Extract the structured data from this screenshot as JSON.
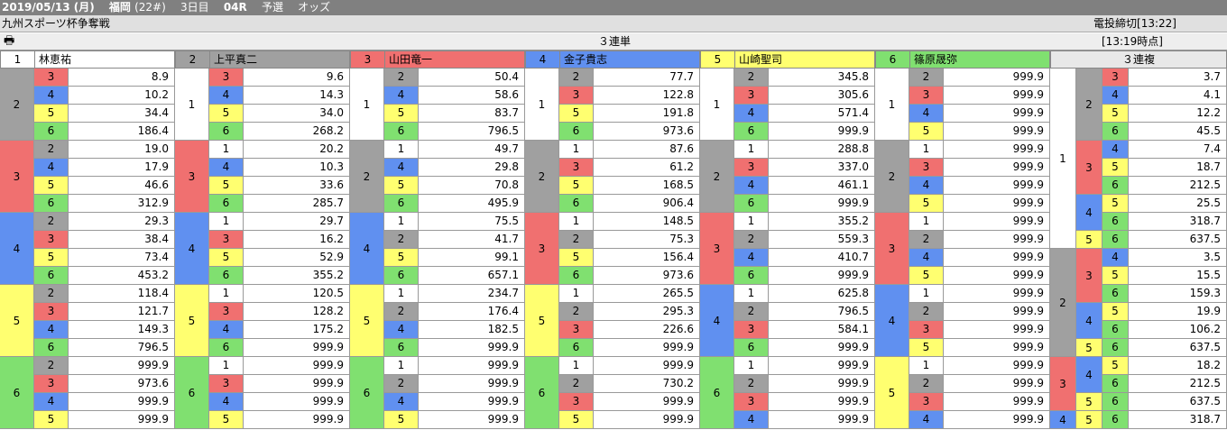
{
  "titlebar": {
    "date": "2019/05/13 (月)",
    "venue": "福岡",
    "count": "(22#)",
    "day": "3日目",
    "race": "04R",
    "stage": "予選",
    "type": "オッズ"
  },
  "subbar": {
    "race_name": "九州スポーツ杯争奪戦",
    "deadline": "電投締切[13:22]"
  },
  "toolbar": {
    "bet_type": "３連単",
    "as_of": "[13:19時点]",
    "trio_label": "３連複"
  },
  "colors": {
    "1": "#ffffff",
    "2": "#a0a0a0",
    "3": "#f07070",
    "4": "#6090f0",
    "5": "#ffff70",
    "6": "#80e070"
  },
  "racers": [
    {
      "no": "1",
      "name": "林恵祐"
    },
    {
      "no": "2",
      "name": "上平真二"
    },
    {
      "no": "3",
      "name": "山田竜一"
    },
    {
      "no": "4",
      "name": "金子貴志"
    },
    {
      "no": "5",
      "name": "山崎聖司"
    },
    {
      "no": "6",
      "name": "篠原晟弥"
    }
  ],
  "trifecta": [
    {
      "first": "1",
      "groups": [
        {
          "second": "2",
          "rows": [
            [
              "3",
              "8.9"
            ],
            [
              "4",
              "10.2"
            ],
            [
              "5",
              "34.4"
            ],
            [
              "6",
              "186.4"
            ]
          ]
        },
        {
          "second": "3",
          "rows": [
            [
              "2",
              "19.0"
            ],
            [
              "4",
              "17.9"
            ],
            [
              "5",
              "46.6"
            ],
            [
              "6",
              "312.9"
            ]
          ]
        },
        {
          "second": "4",
          "rows": [
            [
              "2",
              "29.3"
            ],
            [
              "3",
              "38.4"
            ],
            [
              "5",
              "73.4"
            ],
            [
              "6",
              "453.2"
            ]
          ]
        },
        {
          "second": "5",
          "rows": [
            [
              "2",
              "118.4"
            ],
            [
              "3",
              "121.7"
            ],
            [
              "4",
              "149.3"
            ],
            [
              "6",
              "796.5"
            ]
          ]
        },
        {
          "second": "6",
          "rows": [
            [
              "2",
              "999.9"
            ],
            [
              "3",
              "973.6"
            ],
            [
              "4",
              "999.9"
            ],
            [
              "5",
              "999.9"
            ]
          ]
        }
      ]
    },
    {
      "first": "2",
      "groups": [
        {
          "second": "1",
          "rows": [
            [
              "3",
              "9.6"
            ],
            [
              "4",
              "14.3"
            ],
            [
              "5",
              "34.0"
            ],
            [
              "6",
              "268.2"
            ]
          ]
        },
        {
          "second": "3",
          "rows": [
            [
              "1",
              "20.2"
            ],
            [
              "4",
              "10.3"
            ],
            [
              "5",
              "33.6"
            ],
            [
              "6",
              "285.7"
            ]
          ]
        },
        {
          "second": "4",
          "rows": [
            [
              "1",
              "29.7"
            ],
            [
              "3",
              "16.2"
            ],
            [
              "5",
              "52.9"
            ],
            [
              "6",
              "355.2"
            ]
          ]
        },
        {
          "second": "5",
          "rows": [
            [
              "1",
              "120.5"
            ],
            [
              "3",
              "128.2"
            ],
            [
              "4",
              "175.2"
            ],
            [
              "6",
              "999.9"
            ]
          ]
        },
        {
          "second": "6",
          "rows": [
            [
              "1",
              "999.9"
            ],
            [
              "3",
              "999.9"
            ],
            [
              "4",
              "999.9"
            ],
            [
              "5",
              "999.9"
            ]
          ]
        }
      ]
    },
    {
      "first": "3",
      "groups": [
        {
          "second": "1",
          "rows": [
            [
              "2",
              "50.4"
            ],
            [
              "4",
              "58.6"
            ],
            [
              "5",
              "83.7"
            ],
            [
              "6",
              "796.5"
            ]
          ]
        },
        {
          "second": "2",
          "rows": [
            [
              "1",
              "49.7"
            ],
            [
              "4",
              "29.8"
            ],
            [
              "5",
              "70.8"
            ],
            [
              "6",
              "495.9"
            ]
          ]
        },
        {
          "second": "4",
          "rows": [
            [
              "1",
              "75.5"
            ],
            [
              "2",
              "41.7"
            ],
            [
              "5",
              "99.1"
            ],
            [
              "6",
              "657.1"
            ]
          ]
        },
        {
          "second": "5",
          "rows": [
            [
              "1",
              "234.7"
            ],
            [
              "2",
              "176.4"
            ],
            [
              "4",
              "182.5"
            ],
            [
              "6",
              "999.9"
            ]
          ]
        },
        {
          "second": "6",
          "rows": [
            [
              "1",
              "999.9"
            ],
            [
              "2",
              "999.9"
            ],
            [
              "4",
              "999.9"
            ],
            [
              "5",
              "999.9"
            ]
          ]
        }
      ]
    },
    {
      "first": "4",
      "groups": [
        {
          "second": "1",
          "rows": [
            [
              "2",
              "77.7"
            ],
            [
              "3",
              "122.8"
            ],
            [
              "5",
              "191.8"
            ],
            [
              "6",
              "973.6"
            ]
          ]
        },
        {
          "second": "2",
          "rows": [
            [
              "1",
              "87.6"
            ],
            [
              "3",
              "61.2"
            ],
            [
              "5",
              "168.5"
            ],
            [
              "6",
              "906.4"
            ]
          ]
        },
        {
          "second": "3",
          "rows": [
            [
              "1",
              "148.5"
            ],
            [
              "2",
              "75.3"
            ],
            [
              "5",
              "156.4"
            ],
            [
              "6",
              "973.6"
            ]
          ]
        },
        {
          "second": "5",
          "rows": [
            [
              "1",
              "265.5"
            ],
            [
              "2",
              "295.3"
            ],
            [
              "3",
              "226.6"
            ],
            [
              "6",
              "999.9"
            ]
          ]
        },
        {
          "second": "6",
          "rows": [
            [
              "1",
              "999.9"
            ],
            [
              "2",
              "730.2"
            ],
            [
              "3",
              "999.9"
            ],
            [
              "5",
              "999.9"
            ]
          ]
        }
      ]
    },
    {
      "first": "5",
      "groups": [
        {
          "second": "1",
          "rows": [
            [
              "2",
              "345.8"
            ],
            [
              "3",
              "305.6"
            ],
            [
              "4",
              "571.4"
            ],
            [
              "6",
              "999.9"
            ]
          ]
        },
        {
          "second": "2",
          "rows": [
            [
              "1",
              "288.8"
            ],
            [
              "3",
              "337.0"
            ],
            [
              "4",
              "461.1"
            ],
            [
              "6",
              "999.9"
            ]
          ]
        },
        {
          "second": "3",
          "rows": [
            [
              "1",
              "355.2"
            ],
            [
              "2",
              "559.3"
            ],
            [
              "4",
              "410.7"
            ],
            [
              "6",
              "999.9"
            ]
          ]
        },
        {
          "second": "4",
          "rows": [
            [
              "1",
              "625.8"
            ],
            [
              "2",
              "796.5"
            ],
            [
              "3",
              "584.1"
            ],
            [
              "6",
              "999.9"
            ]
          ]
        },
        {
          "second": "6",
          "rows": [
            [
              "1",
              "999.9"
            ],
            [
              "2",
              "999.9"
            ],
            [
              "3",
              "999.9"
            ],
            [
              "4",
              "999.9"
            ]
          ]
        }
      ]
    },
    {
      "first": "6",
      "groups": [
        {
          "second": "1",
          "rows": [
            [
              "2",
              "999.9"
            ],
            [
              "3",
              "999.9"
            ],
            [
              "4",
              "999.9"
            ],
            [
              "5",
              "999.9"
            ]
          ]
        },
        {
          "second": "2",
          "rows": [
            [
              "1",
              "999.9"
            ],
            [
              "3",
              "999.9"
            ],
            [
              "4",
              "999.9"
            ],
            [
              "5",
              "999.9"
            ]
          ]
        },
        {
          "second": "3",
          "rows": [
            [
              "1",
              "999.9"
            ],
            [
              "2",
              "999.9"
            ],
            [
              "4",
              "999.9"
            ],
            [
              "5",
              "999.9"
            ]
          ]
        },
        {
          "second": "4",
          "rows": [
            [
              "1",
              "999.9"
            ],
            [
              "2",
              "999.9"
            ],
            [
              "3",
              "999.9"
            ],
            [
              "5",
              "999.9"
            ]
          ]
        },
        {
          "second": "5",
          "rows": [
            [
              "1",
              "999.9"
            ],
            [
              "2",
              "999.9"
            ],
            [
              "3",
              "999.9"
            ],
            [
              "4",
              "999.9"
            ]
          ]
        }
      ]
    }
  ],
  "trio": [
    {
      "first": "1",
      "groups": [
        {
          "second": "2",
          "rows": [
            [
              "3",
              "3.7"
            ],
            [
              "4",
              "4.1"
            ],
            [
              "5",
              "12.2"
            ],
            [
              "6",
              "45.5"
            ]
          ]
        },
        {
          "second": "3",
          "rows": [
            [
              "4",
              "7.4"
            ],
            [
              "5",
              "18.7"
            ],
            [
              "6",
              "212.5"
            ]
          ]
        },
        {
          "second": "4",
          "rows": [
            [
              "5",
              "25.5"
            ],
            [
              "6",
              "318.7"
            ]
          ]
        },
        {
          "second": "5",
          "rows": [
            [
              "6",
              "637.5"
            ]
          ]
        }
      ]
    },
    {
      "first": "2",
      "groups": [
        {
          "second": "3",
          "rows": [
            [
              "4",
              "3.5"
            ],
            [
              "5",
              "15.5"
            ],
            [
              "6",
              "159.3"
            ]
          ]
        },
        {
          "second": "4",
          "rows": [
            [
              "5",
              "19.9"
            ],
            [
              "6",
              "106.2"
            ]
          ]
        },
        {
          "second": "5",
          "rows": [
            [
              "6",
              "637.5"
            ]
          ]
        }
      ]
    },
    {
      "first": "3",
      "groups": [
        {
          "second": "4",
          "rows": [
            [
              "5",
              "18.2"
            ],
            [
              "6",
              "212.5"
            ]
          ]
        },
        {
          "second": "5",
          "rows": [
            [
              "6",
              "637.5"
            ]
          ]
        }
      ]
    },
    {
      "first": "4",
      "groups": [
        {
          "second": "5",
          "rows": [
            [
              "6",
              "318.7"
            ]
          ]
        }
      ]
    }
  ]
}
